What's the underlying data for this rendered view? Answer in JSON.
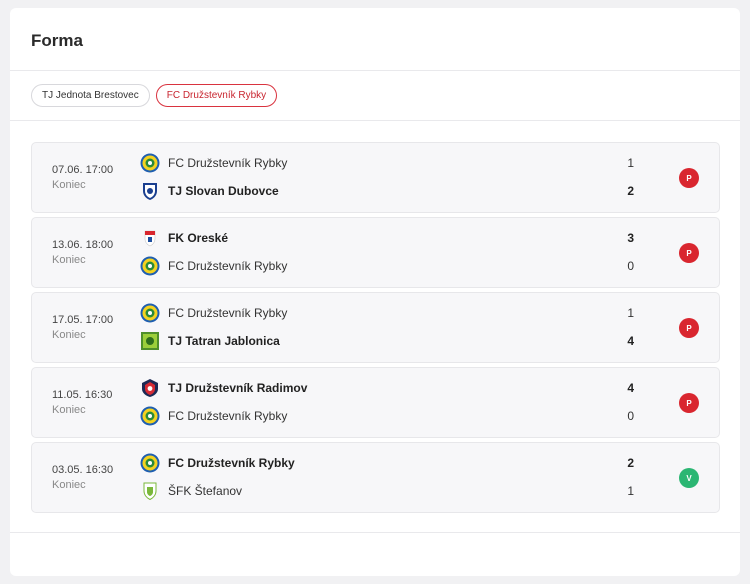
{
  "section": {
    "title": "Forma"
  },
  "tabs": [
    {
      "label": "TJ Jednota Brestovec",
      "active": false
    },
    {
      "label": "FC Družstevník Rybky",
      "active": true
    }
  ],
  "colors": {
    "loss": "#d9262f",
    "win": "#2bb673",
    "accent": "#d9333f"
  },
  "matches": [
    {
      "date": "07.06. 17:00",
      "status": "Koniec",
      "home": {
        "name": "FC Družstevník Rybky",
        "score": "1",
        "logo": "rybky-crest-icon",
        "winner": false
      },
      "away": {
        "name": "TJ Slovan Dubovce",
        "score": "2",
        "logo": "dubovce-crest-icon",
        "winner": true
      },
      "result": "P"
    },
    {
      "date": "13.06. 18:00",
      "status": "Koniec",
      "home": {
        "name": "FK Oreské",
        "score": "3",
        "logo": "oreske-crest-icon",
        "winner": true
      },
      "away": {
        "name": "FC Družstevník Rybky",
        "score": "0",
        "logo": "rybky-crest-icon",
        "winner": false
      },
      "result": "P"
    },
    {
      "date": "17.05. 17:00",
      "status": "Koniec",
      "home": {
        "name": "FC Družstevník Rybky",
        "score": "1",
        "logo": "rybky-crest-icon",
        "winner": false
      },
      "away": {
        "name": "TJ Tatran Jablonica",
        "score": "4",
        "logo": "jablonica-crest-icon",
        "winner": true
      },
      "result": "P"
    },
    {
      "date": "11.05. 16:30",
      "status": "Koniec",
      "home": {
        "name": "TJ Družstevník Radimov",
        "score": "4",
        "logo": "radimov-crest-icon",
        "winner": true
      },
      "away": {
        "name": "FC Družstevník Rybky",
        "score": "0",
        "logo": "rybky-crest-icon",
        "winner": false
      },
      "result": "P"
    },
    {
      "date": "03.05. 16:30",
      "status": "Koniec",
      "home": {
        "name": "FC Družstevník Rybky",
        "score": "2",
        "logo": "rybky-crest-icon",
        "winner": true
      },
      "away": {
        "name": "ŠFK Štefanov",
        "score": "1",
        "logo": "stefanov-crest-icon",
        "winner": false
      },
      "result": "V"
    }
  ]
}
